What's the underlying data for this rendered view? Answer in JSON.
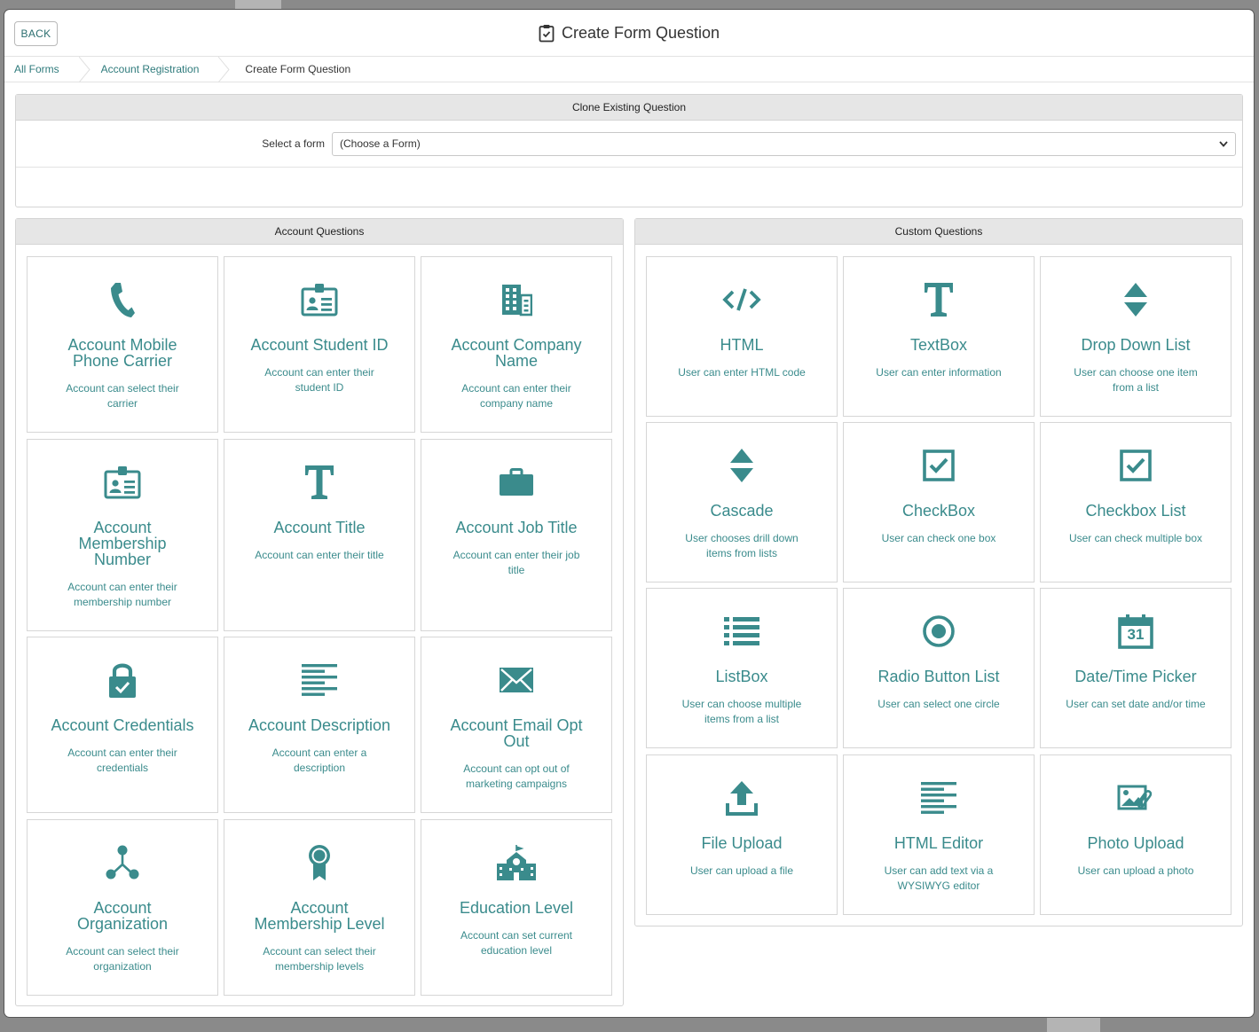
{
  "colors": {
    "accent": "#3a8b8c",
    "panel_header": "#e6e6e6",
    "border": "#d6d6d6"
  },
  "header": {
    "back_label": "BACK",
    "title": "Create Form Question",
    "title_icon": "clipboard-check-icon"
  },
  "breadcrumb": {
    "items": [
      "All Forms",
      "Account Registration",
      "Create Form Question"
    ]
  },
  "clone": {
    "title": "Clone Existing Question",
    "select_label": "Select a form",
    "select_value": "(Choose a Form)"
  },
  "account_questions": {
    "title": "Account Questions",
    "cards": [
      {
        "icon": "phone-icon",
        "title": "Account Mobile Phone Carrier",
        "desc": "Account can select their carrier"
      },
      {
        "icon": "id-card-icon",
        "title": "Account Student ID",
        "desc": "Account can enter their student ID"
      },
      {
        "icon": "building-icon",
        "title": "Account Company Name",
        "desc": "Account can enter their company name"
      },
      {
        "icon": "id-card-icon",
        "title": "Account Membership Number",
        "desc": "Account can enter their membership number"
      },
      {
        "icon": "title-t-icon",
        "title": "Account Title",
        "desc": "Account can enter their title"
      },
      {
        "icon": "briefcase-icon",
        "title": "Account Job Title",
        "desc": "Account can enter their job title"
      },
      {
        "icon": "lock-check-icon",
        "title": "Account Credentials",
        "desc": "Account can enter their credentials"
      },
      {
        "icon": "align-left-icon",
        "title": "Account Description",
        "desc": "Account can enter a description"
      },
      {
        "icon": "envelope-icon",
        "title": "Account Email Opt Out",
        "desc": "Account can opt out of marketing campaigns"
      },
      {
        "icon": "organization-icon",
        "title": "Account Organization",
        "desc": "Account can select their organization"
      },
      {
        "icon": "award-ribbon-icon",
        "title": "Account Membership Level",
        "desc": "Account can select their membership levels"
      },
      {
        "icon": "school-icon",
        "title": "Education Level",
        "desc": "Account can set current education level"
      }
    ]
  },
  "custom_questions": {
    "title": "Custom Questions",
    "cards": [
      {
        "icon": "code-icon",
        "title": "HTML",
        "desc": "User can enter HTML code"
      },
      {
        "icon": "title-t-icon",
        "title": "TextBox",
        "desc": "User can enter information"
      },
      {
        "icon": "sort-arrows-icon",
        "title": "Drop Down List",
        "desc": "User can choose one item from a list"
      },
      {
        "icon": "sort-arrows-icon",
        "title": "Cascade",
        "desc": "User chooses drill down items from lists"
      },
      {
        "icon": "checkbox-icon",
        "title": "CheckBox",
        "desc": "User can check one box"
      },
      {
        "icon": "checkbox-icon",
        "title": "Checkbox List",
        "desc": "User can check multiple box"
      },
      {
        "icon": "list-icon",
        "title": "ListBox",
        "desc": "User can choose multiple items from a list"
      },
      {
        "icon": "radio-icon",
        "title": "Radio Button List",
        "desc": "User can select one circle"
      },
      {
        "icon": "calendar-icon",
        "title": "Date/Time Picker",
        "desc": "User can set date and/or time",
        "icon_text": "31"
      },
      {
        "icon": "upload-icon",
        "title": "File Upload",
        "desc": "User can upload a file"
      },
      {
        "icon": "align-left-icon",
        "title": "HTML Editor",
        "desc": "User can add text via a WYSIWYG editor"
      },
      {
        "icon": "photo-attach-icon",
        "title": "Photo Upload",
        "desc": "User can upload a photo"
      }
    ]
  }
}
